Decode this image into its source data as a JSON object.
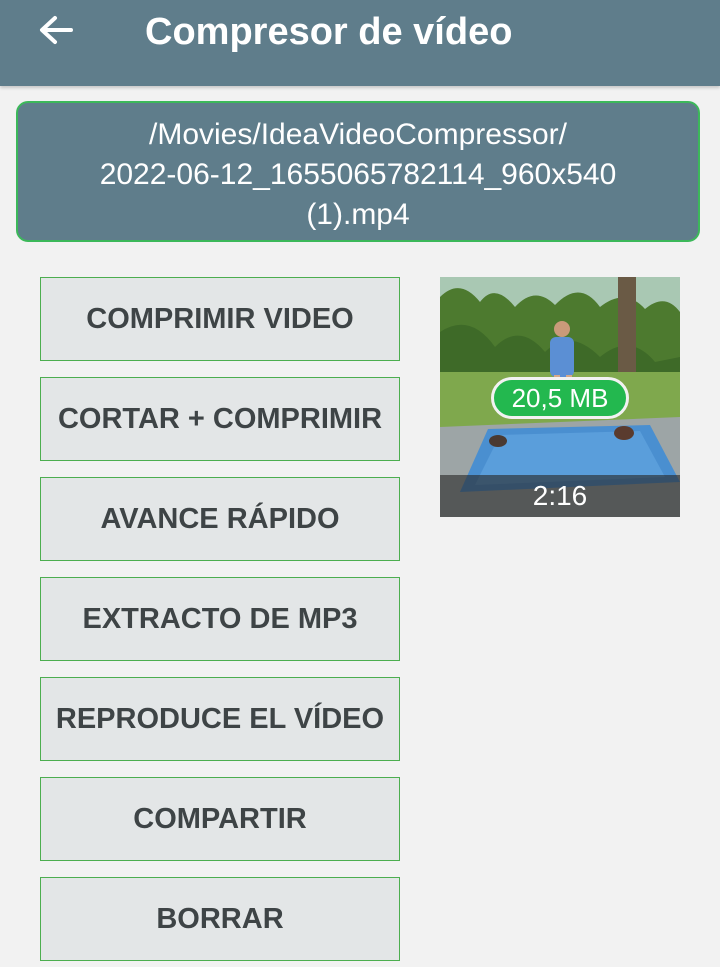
{
  "header": {
    "title": "Compresor de vídeo",
    "back_icon": "arrow-left-icon"
  },
  "file": {
    "path_lines": [
      "/Movies/IdeaVideoCompressor/",
      "2022-06-12_1655065782114_960x540",
      "(1).mp4"
    ]
  },
  "actions": [
    {
      "label": "COMPRIMIR VIDEO"
    },
    {
      "label": "CORTAR + COMPRIMIR"
    },
    {
      "label": "AVANCE RÁPIDO"
    },
    {
      "label": "EXTRACTO DE MP3"
    },
    {
      "label": "REPRODUCE EL VÍDEO"
    },
    {
      "label": "COMPARTIR"
    },
    {
      "label": "BORRAR"
    }
  ],
  "video": {
    "size": "20,5 MB",
    "duration": "2:16"
  },
  "colors": {
    "appbar": "#5f7d8b",
    "accent_green": "#3cb85a",
    "badge_green": "#23b84f",
    "button_bg": "#e3e6e7",
    "button_text": "#3e4446",
    "background": "#f2f2f2"
  }
}
